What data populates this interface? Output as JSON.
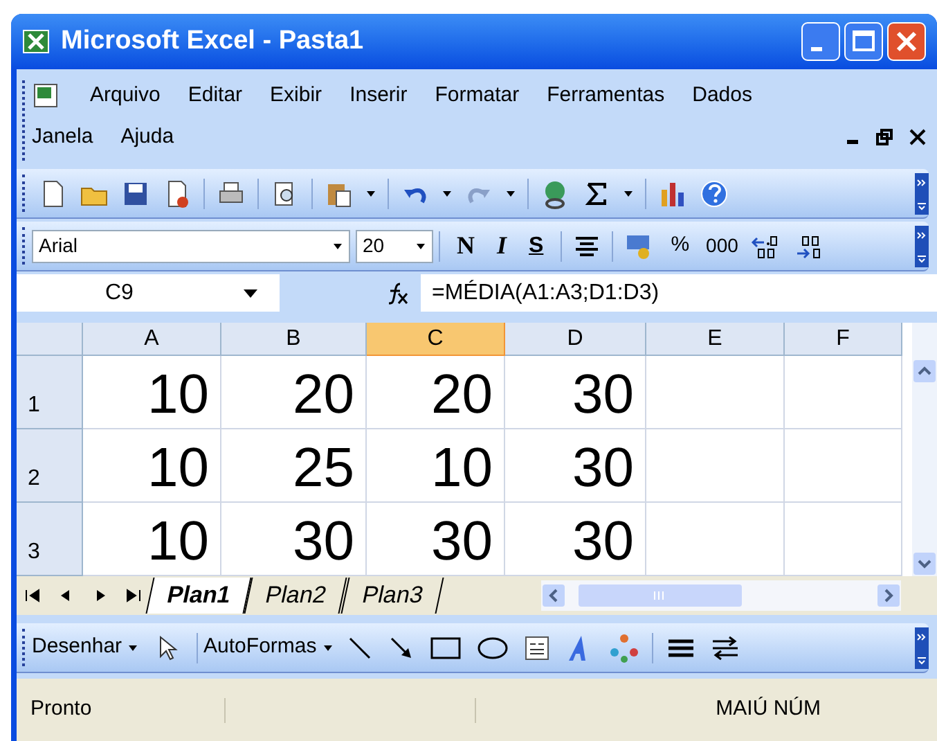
{
  "window": {
    "title": "Microsoft Excel - Pasta1"
  },
  "menu_bar": {
    "items": [
      "Arquivo",
      "Editar",
      "Exibir",
      "Inserir",
      "Formatar",
      "Ferramentas",
      "Dados",
      "Janela",
      "Ajuda"
    ]
  },
  "formatting_toolbar": {
    "font": "Arial",
    "size": "20",
    "bold": "N",
    "italic": "I",
    "underline": "S",
    "percent": "%",
    "thousands": "000"
  },
  "formula_bar": {
    "name_box": "C9",
    "formula": "=MÉDIA(A1:A3;D1:D3)"
  },
  "sheet": {
    "columns": [
      {
        "label": "A",
        "selected": false
      },
      {
        "label": "B",
        "selected": false
      },
      {
        "label": "C",
        "selected": true
      },
      {
        "label": "D",
        "selected": false
      },
      {
        "label": "E",
        "selected": false
      },
      {
        "label": "F",
        "selected": false
      }
    ],
    "rows": [
      {
        "header": "1",
        "cells": [
          "10",
          "20",
          "20",
          "30",
          "",
          ""
        ]
      },
      {
        "header": "2",
        "cells": [
          "10",
          "25",
          "10",
          "30",
          "",
          ""
        ]
      },
      {
        "header": "3",
        "cells": [
          "10",
          "30",
          "30",
          "30",
          "",
          ""
        ]
      }
    ]
  },
  "sheet_tabs": [
    {
      "label": "Plan1",
      "selected": true
    },
    {
      "label": "Plan2",
      "selected": false
    },
    {
      "label": "Plan3",
      "selected": false
    }
  ],
  "drawing_toolbar": {
    "draw_menu": "Desenhar",
    "autoshapes_menu": "AutoFormas"
  },
  "status_bar": {
    "message": "Pronto",
    "indicators": "MAIÚ NÚM"
  }
}
